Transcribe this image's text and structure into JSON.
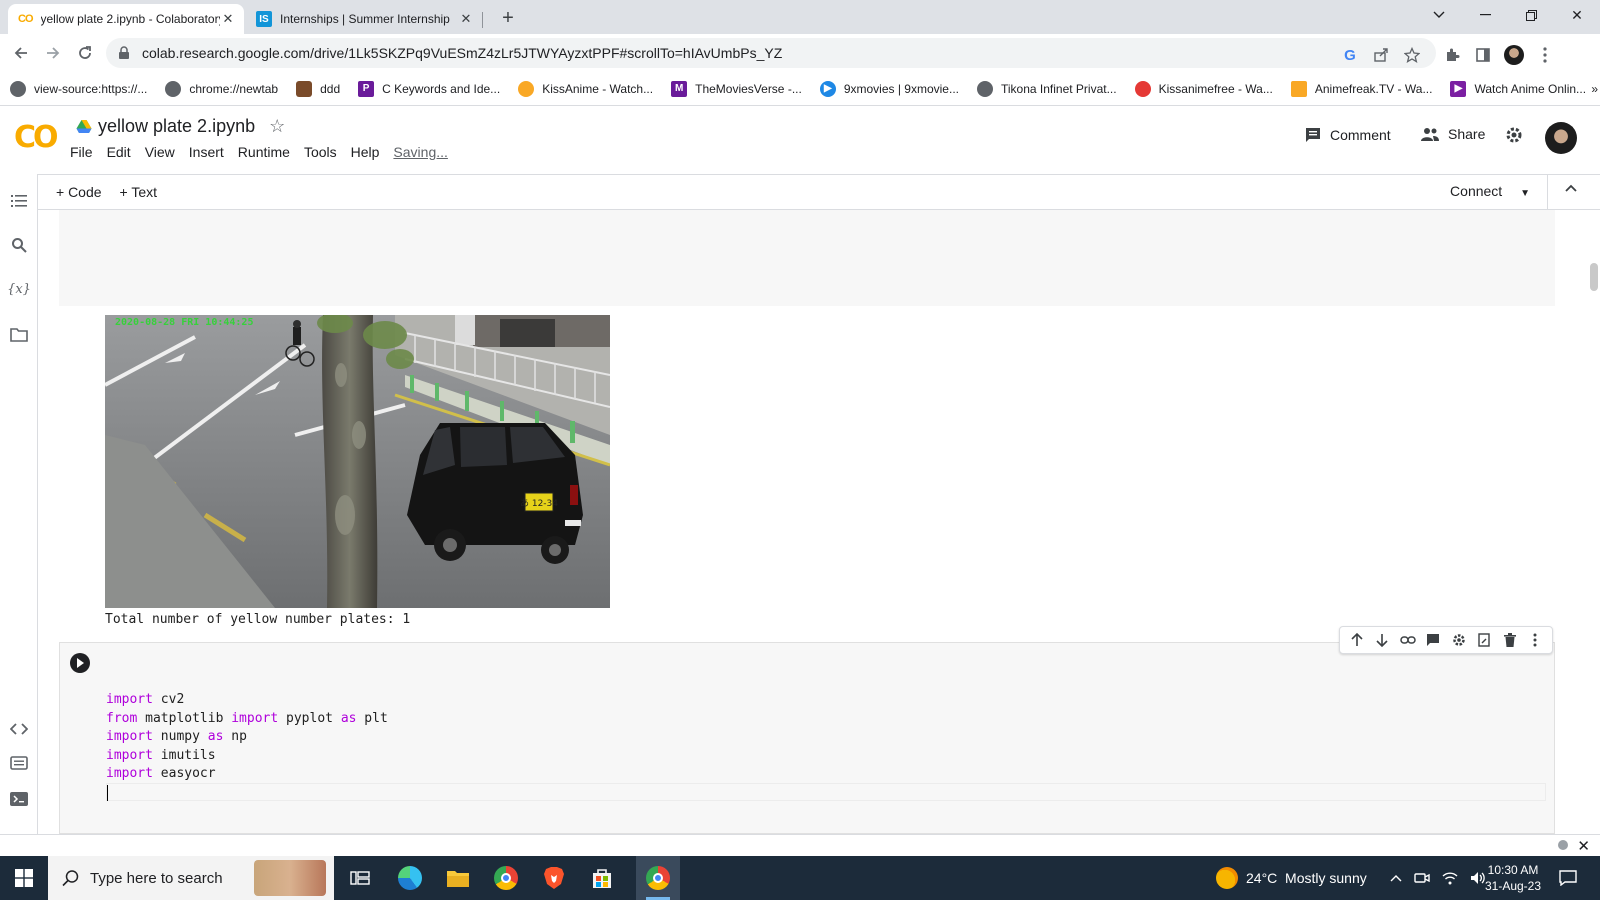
{
  "browser": {
    "tabs": [
      {
        "title": "yellow plate 2.ipynb - Colaboratory",
        "active": true,
        "favicon": "colab-icon"
      },
      {
        "title": "Internships | Summer Internship",
        "active": false,
        "favicon": "internshala-icon"
      }
    ],
    "url": "colab.research.google.com/drive/1Lk5SKZPq9VuESmZ4zLr5JTWYAyzxtPPF#scrollTo=hIAvUmbPs_YZ"
  },
  "bookmarks": [
    {
      "label": "view-source:https://...",
      "color": "#5f6368"
    },
    {
      "label": "chrome://newtab",
      "color": "#5f6368"
    },
    {
      "label": "ddd",
      "color": "#7a4b2a"
    },
    {
      "label": "C Keywords and Ide...",
      "color": "#6a1b9a"
    },
    {
      "label": "KissAnime - Watch...",
      "color": "#f9a825"
    },
    {
      "label": "TheMoviesVerse -...",
      "color": "#6a1b9a"
    },
    {
      "label": "9xmovies | 9xmovie...",
      "color": "#1e88e5"
    },
    {
      "label": "Tikona Infinet Privat...",
      "color": "#5f6368"
    },
    {
      "label": "Kissanimefree - Wa...",
      "color": "#e53935"
    },
    {
      "label": "Animefreak.TV - Wa...",
      "color": "#f9a825"
    },
    {
      "label": "Watch Anime Onlin...",
      "color": "#7b1fa2"
    }
  ],
  "colab": {
    "logo": "CO",
    "title": "yellow plate 2.ipynb",
    "menu": [
      "File",
      "Edit",
      "View",
      "Insert",
      "Runtime",
      "Tools",
      "Help"
    ],
    "saving": "Saving...",
    "comment": "Comment",
    "share": "Share",
    "add_code": "+ Code",
    "add_text": "+ Text",
    "connect": "Connect"
  },
  "image": {
    "timestamp": "2020-08-28 FRI 10:44:25",
    "plate_text": "あ 12-34"
  },
  "output": {
    "text": "Total number of yellow number plates: 1"
  },
  "code_cell": {
    "lines": [
      {
        "kw": "import",
        "rest": " cv2"
      },
      {
        "kw": "from",
        "rest": " matplotlib ",
        "kw2": "import",
        "rest2": " pyplot ",
        "kw3": "as",
        "rest3": " plt"
      },
      {
        "kw": "import",
        "rest": " numpy ",
        "kw2": "as",
        "rest2": " np"
      },
      {
        "kw": "import",
        "rest": " imutils"
      },
      {
        "kw": "import",
        "rest": " easyocr"
      }
    ]
  },
  "taskbar": {
    "search_placeholder": "Type here to search",
    "weather": "24°C  Mostly sunny",
    "time": "10:30 AM",
    "date": "31-Aug-23"
  },
  "colors": {
    "keyword": "#af00db",
    "colab_orange": "#f9ab00",
    "taskbar": "#1c2b3a"
  }
}
